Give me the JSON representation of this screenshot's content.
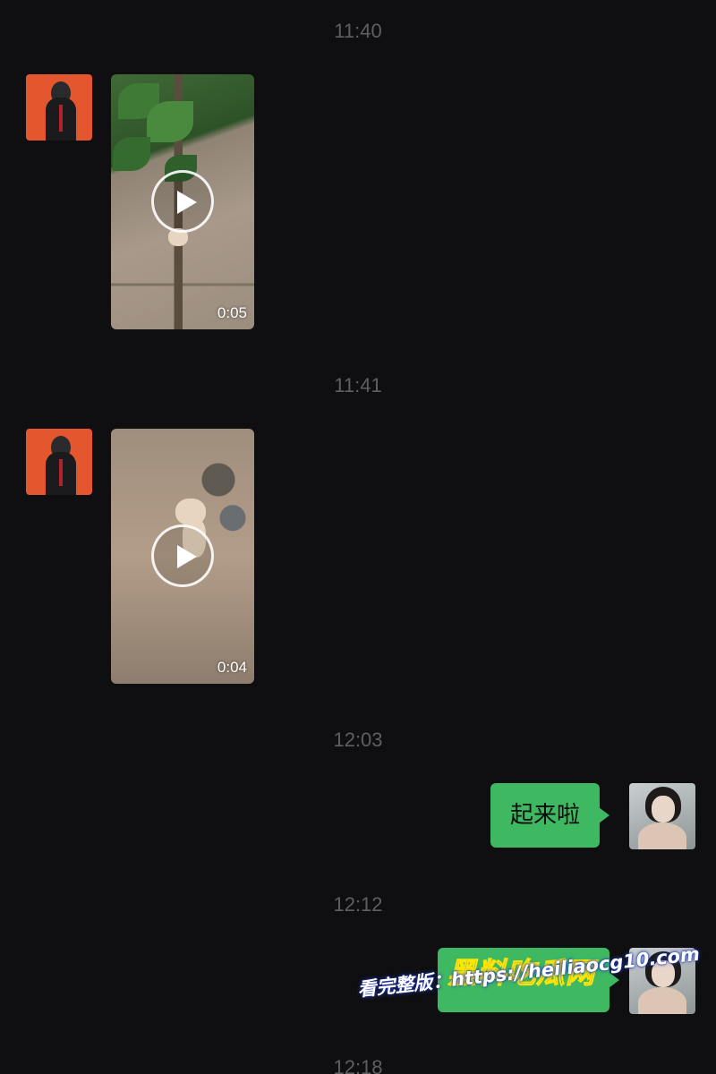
{
  "chat": {
    "messages": [
      {
        "type": "timestamp",
        "text": "11:40"
      },
      {
        "type": "video",
        "sender": "contact",
        "duration": "0:05"
      },
      {
        "type": "timestamp",
        "text": "11:41"
      },
      {
        "type": "video",
        "sender": "contact",
        "duration": "0:04"
      },
      {
        "type": "timestamp",
        "text": "12:03"
      },
      {
        "type": "text",
        "sender": "self",
        "text": "起来啦"
      },
      {
        "type": "timestamp",
        "text": "12:12"
      },
      {
        "type": "text",
        "sender": "self",
        "text": ""
      },
      {
        "type": "timestamp",
        "text": "12:18"
      }
    ]
  },
  "watermark": {
    "brand": "黑料吃瓜网",
    "prefix": "看完整版：",
    "url": "https://heiliaocg10.com"
  },
  "colors": {
    "background": "#0f0f11",
    "sent_bubble": "#3eb861",
    "timestamp_text": "#5f5f63",
    "contact_avatar": "#e4572e"
  },
  "icons": {
    "play": "play-icon"
  }
}
